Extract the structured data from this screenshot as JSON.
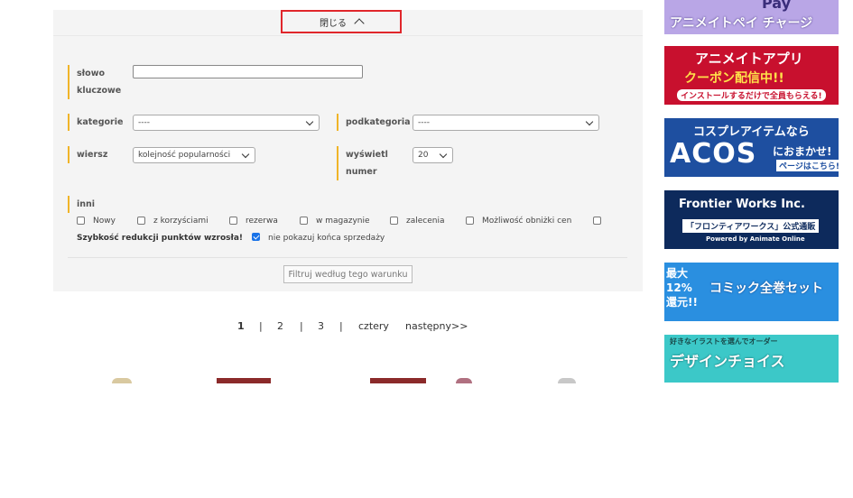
{
  "search_panel": {
    "close_label": "閉じる",
    "keyword_label_1": "słowo",
    "keyword_label_2": "kluczowe",
    "keyword_value": "",
    "category_label": "kategorie",
    "category_value": "----",
    "subcategory_label": "podkategoria",
    "subcategory_value": "----",
    "sort_label": "wiersz",
    "sort_value": "kolejność popularności",
    "display_label_1": "wyświetl",
    "display_label_2": "numer",
    "display_value": "20",
    "other_label": "inni",
    "checkboxes": [
      {
        "label": "Nowy",
        "checked": false
      },
      {
        "label": "z korzyściami",
        "checked": false
      },
      {
        "label": "rezerwa",
        "checked": false
      },
      {
        "label": "w magazynie",
        "checked": false
      },
      {
        "label": "zalecenia",
        "checked": false
      },
      {
        "label": "Możliwość obniżki cen",
        "checked": false
      },
      {
        "label": "Szybkość redukcji punktów wzrosła!",
        "checked": false
      },
      {
        "label": "nie pokazuj końca sprzedaży",
        "checked": true
      }
    ],
    "filter_button": "Filtruj według tego warunku"
  },
  "pagination": {
    "pages": [
      "1",
      "2",
      "3",
      "cztery"
    ],
    "separator": "|",
    "next": "następny>>"
  },
  "banners": [
    {
      "text": "アニメイトペイ チャージ",
      "top_text": "Pay",
      "bg": "#b9a6e6",
      "fg": "#ffffff"
    },
    {
      "text": "アニメイトアプリ",
      "line2": "クーポン配信中!!",
      "line3": "インストールするだけで全員もらえる!",
      "bg": "#c8102e",
      "fg": "#ffffff"
    },
    {
      "text": "コスプレアイテムなら",
      "line2": "ACOS",
      "line3": "におまかせ!",
      "line4": "ページはこちら!",
      "bg": "#1e4fa0",
      "fg": "#ffffff"
    },
    {
      "text": "Frontier Works Inc.",
      "line2": "「フロンティアワークス」公式通販",
      "line3": "Powered by Animate Online",
      "bg": "#0d2a5c",
      "fg": "#ffffff"
    },
    {
      "text": "コミック全巻セット",
      "line2": "最大12%還元!!",
      "bg": "#2a8fe0",
      "fg": "#ffffff"
    },
    {
      "text": "デザインチョイス",
      "line2": "好きなイラストを選んでオーダー",
      "bg": "#3cc8c8",
      "fg": "#ffffff"
    }
  ],
  "colors": {
    "accent": "#f0b428",
    "highlight": "#e0262b",
    "panel_bg": "#f4f4f4"
  }
}
